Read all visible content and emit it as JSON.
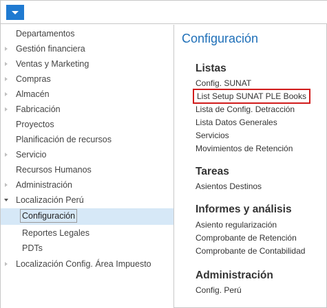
{
  "sidebar": {
    "items": [
      {
        "label": "Departamentos",
        "arrow": false
      },
      {
        "label": "Gestión financiera",
        "arrow": true
      },
      {
        "label": "Ventas y Marketing",
        "arrow": true
      },
      {
        "label": "Compras",
        "arrow": true
      },
      {
        "label": "Almacén",
        "arrow": true
      },
      {
        "label": "Fabricación",
        "arrow": true
      },
      {
        "label": "Proyectos",
        "arrow": false
      },
      {
        "label": "Planificación de recursos",
        "arrow": false
      },
      {
        "label": "Servicio",
        "arrow": true
      },
      {
        "label": "Recursos Humanos",
        "arrow": false
      },
      {
        "label": "Administración",
        "arrow": true
      },
      {
        "label": "Localización Perú",
        "arrow": "open"
      },
      {
        "label": "Configuración",
        "selected": true
      },
      {
        "label": "Reportes Legales"
      },
      {
        "label": "PDTs"
      },
      {
        "label": "Localización Config. Área Impuesto",
        "arrow": true
      }
    ]
  },
  "content": {
    "title": "Configuración",
    "sections": [
      {
        "heading": "Listas",
        "items": [
          "Config. SUNAT",
          "List Setup SUNAT PLE Books",
          "Lista de Config. Detracción",
          "Lista Datos Generales",
          "Servicios",
          "Movimientos de Retención"
        ]
      },
      {
        "heading": "Tareas",
        "items": [
          "Asientos Destinos"
        ]
      },
      {
        "heading": "Informes y análisis",
        "items": [
          "Asiento regularización",
          "Comprobante de Retención",
          "Comprobante de Contabilidad"
        ]
      },
      {
        "heading": "Administración",
        "items": [
          "Config. Perú"
        ]
      }
    ]
  },
  "colors": {
    "accent": "#1f7ad1",
    "title": "#1e6fb8",
    "selected_bg": "#d6e8f7",
    "highlight_box": "#d11b1b"
  }
}
